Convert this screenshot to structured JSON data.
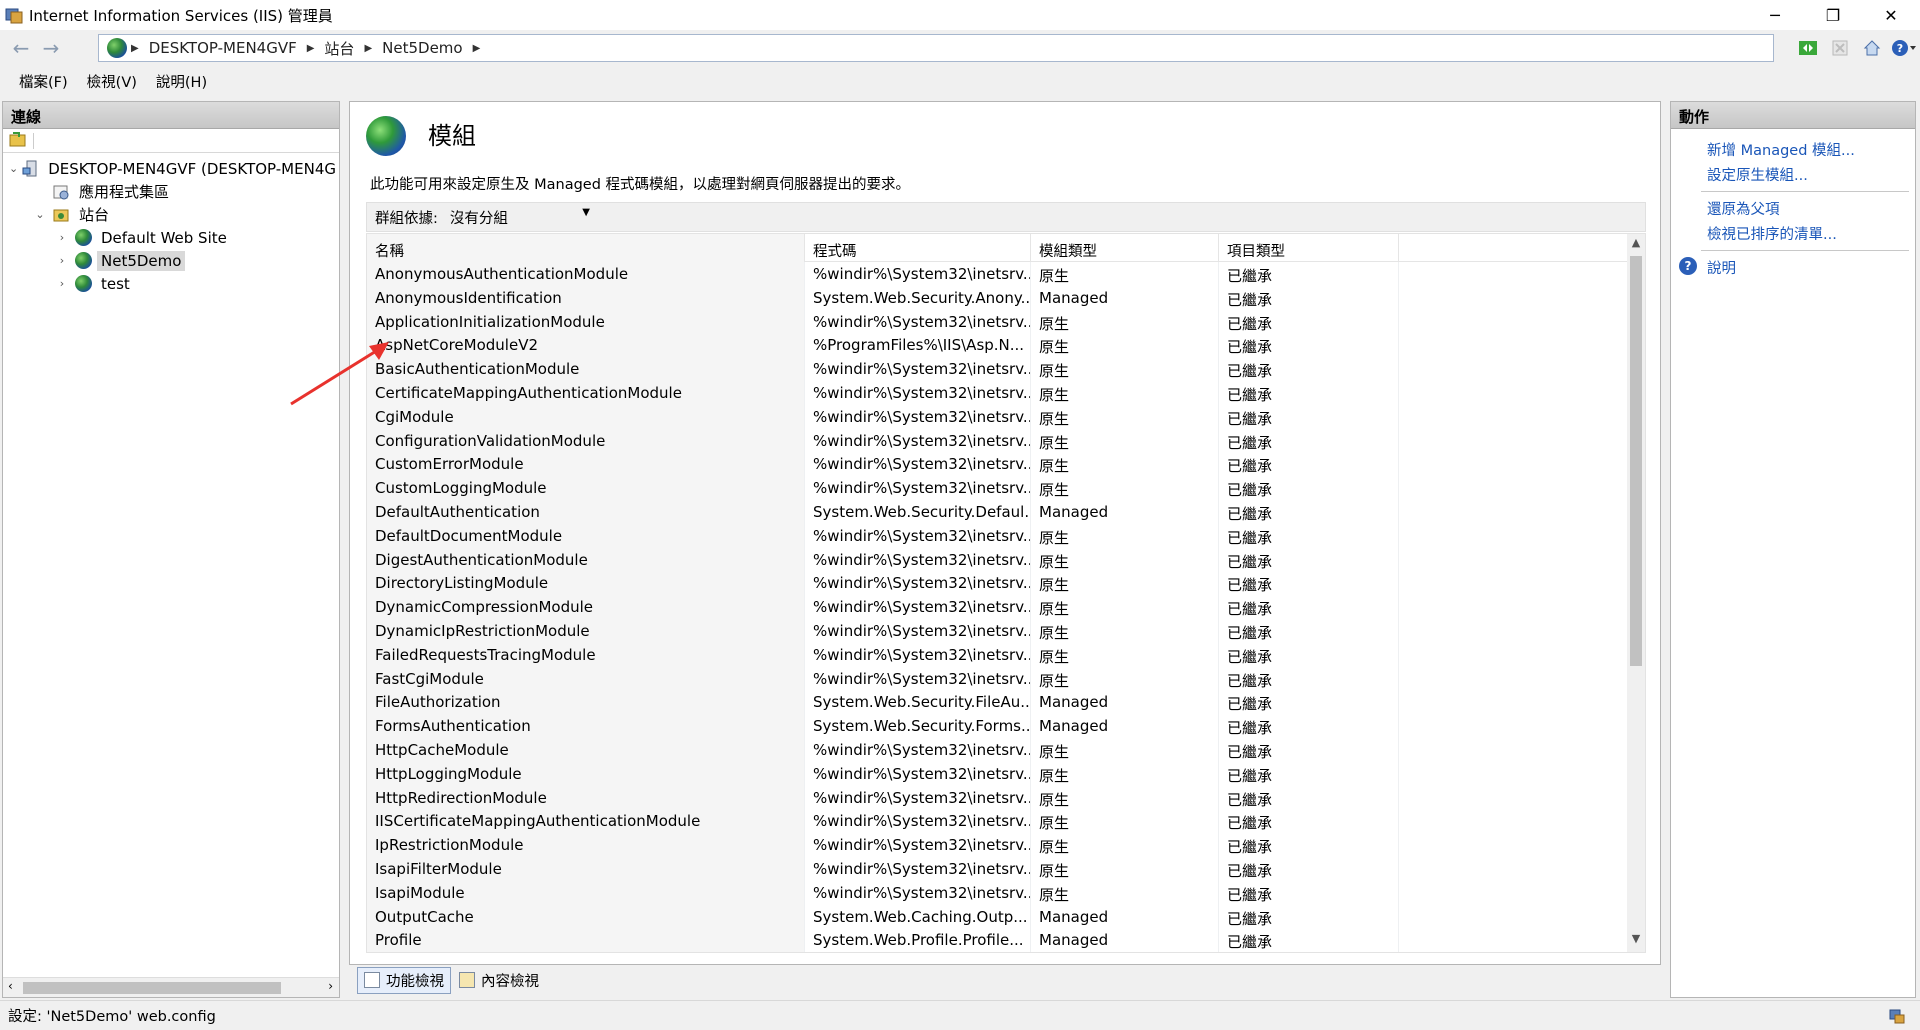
{
  "window": {
    "title": "Internet Information Services (IIS) 管理員",
    "controls": {
      "minimize": "─",
      "restore": "❐",
      "close": "✕"
    }
  },
  "address": {
    "crumbs": [
      "DESKTOP-MEN4GVF",
      "站台",
      "Net5Demo"
    ]
  },
  "menu": [
    "檔案(F)",
    "檢視(V)",
    "說明(H)"
  ],
  "connections": {
    "header": "連線",
    "tree": [
      {
        "label": "DESKTOP-MEN4GVF (DESKTOP-MEN4G",
        "icon": "server-icon",
        "expander": "⌄"
      },
      {
        "label": "應用程式集區",
        "icon": "app-pool-icon",
        "expander": ""
      },
      {
        "label": "站台",
        "icon": "sites-folder-icon",
        "expander": "⌄"
      },
      {
        "label": "Default Web Site",
        "icon": "globe-icon",
        "expander": "›"
      },
      {
        "label": "Net5Demo",
        "icon": "globe-icon",
        "expander": "›",
        "selected": true
      },
      {
        "label": "test",
        "icon": "globe-icon",
        "expander": "›"
      }
    ]
  },
  "feature": {
    "title": "模組",
    "description": "此功能可用來設定原生及 Managed 程式碼模組，以處理對網頁伺服器提出的要求。",
    "group_label": "群組依據:",
    "group_value": "沒有分組"
  },
  "table": {
    "headers": [
      "名稱",
      "程式碼",
      "模組類型",
      "項目類型"
    ],
    "rows": [
      [
        "AnonymousAuthenticationModule",
        "%windir%\\System32\\inetsrv...",
        "原生",
        "已繼承"
      ],
      [
        "AnonymousIdentification",
        "System.Web.Security.Anony...",
        "Managed",
        "已繼承"
      ],
      [
        "ApplicationInitializationModule",
        "%windir%\\System32\\inetsrv...",
        "原生",
        "已繼承"
      ],
      [
        "AspNetCoreModuleV2",
        "%ProgramFiles%\\IIS\\Asp.N...",
        "原生",
        "已繼承"
      ],
      [
        "BasicAuthenticationModule",
        "%windir%\\System32\\inetsrv...",
        "原生",
        "已繼承"
      ],
      [
        "CertificateMappingAuthenticationModule",
        "%windir%\\System32\\inetsrv...",
        "原生",
        "已繼承"
      ],
      [
        "CgiModule",
        "%windir%\\System32\\inetsrv...",
        "原生",
        "已繼承"
      ],
      [
        "ConfigurationValidationModule",
        "%windir%\\System32\\inetsrv...",
        "原生",
        "已繼承"
      ],
      [
        "CustomErrorModule",
        "%windir%\\System32\\inetsrv...",
        "原生",
        "已繼承"
      ],
      [
        "CustomLoggingModule",
        "%windir%\\System32\\inetsrv...",
        "原生",
        "已繼承"
      ],
      [
        "DefaultAuthentication",
        "System.Web.Security.Defaul...",
        "Managed",
        "已繼承"
      ],
      [
        "DefaultDocumentModule",
        "%windir%\\System32\\inetsrv...",
        "原生",
        "已繼承"
      ],
      [
        "DigestAuthenticationModule",
        "%windir%\\System32\\inetsrv...",
        "原生",
        "已繼承"
      ],
      [
        "DirectoryListingModule",
        "%windir%\\System32\\inetsrv...",
        "原生",
        "已繼承"
      ],
      [
        "DynamicCompressionModule",
        "%windir%\\System32\\inetsrv...",
        "原生",
        "已繼承"
      ],
      [
        "DynamicIpRestrictionModule",
        "%windir%\\System32\\inetsrv...",
        "原生",
        "已繼承"
      ],
      [
        "FailedRequestsTracingModule",
        "%windir%\\System32\\inetsrv...",
        "原生",
        "已繼承"
      ],
      [
        "FastCgiModule",
        "%windir%\\System32\\inetsrv...",
        "原生",
        "已繼承"
      ],
      [
        "FileAuthorization",
        "System.Web.Security.FileAu...",
        "Managed",
        "已繼承"
      ],
      [
        "FormsAuthentication",
        "System.Web.Security.Forms...",
        "Managed",
        "已繼承"
      ],
      [
        "HttpCacheModule",
        "%windir%\\System32\\inetsrv...",
        "原生",
        "已繼承"
      ],
      [
        "HttpLoggingModule",
        "%windir%\\System32\\inetsrv...",
        "原生",
        "已繼承"
      ],
      [
        "HttpRedirectionModule",
        "%windir%\\System32\\inetsrv...",
        "原生",
        "已繼承"
      ],
      [
        "IISCertificateMappingAuthenticationModule",
        "%windir%\\System32\\inetsrv...",
        "原生",
        "已繼承"
      ],
      [
        "IpRestrictionModule",
        "%windir%\\System32\\inetsrv...",
        "原生",
        "已繼承"
      ],
      [
        "IsapiFilterModule",
        "%windir%\\System32\\inetsrv...",
        "原生",
        "已繼承"
      ],
      [
        "IsapiModule",
        "%windir%\\System32\\inetsrv...",
        "原生",
        "已繼承"
      ],
      [
        "OutputCache",
        "System.Web.Caching.Outp...",
        "Managed",
        "已繼承"
      ],
      [
        "Profile",
        "System.Web.Profile.Profile...",
        "Managed",
        "已繼承"
      ]
    ]
  },
  "view_tabs": [
    "功能檢視",
    "內容檢視"
  ],
  "actions": {
    "header": "動作",
    "group1": [
      "新增 Managed 模組...",
      "設定原生模組..."
    ],
    "group2": [
      "還原為父項",
      "檢視已排序的清單..."
    ],
    "help": "說明"
  },
  "status": {
    "text": "設定: 'Net5Demo' web.config"
  },
  "colors": {
    "link": "#1a56b8",
    "arrow": "#e8322d",
    "selection": "#d9d9d9"
  }
}
